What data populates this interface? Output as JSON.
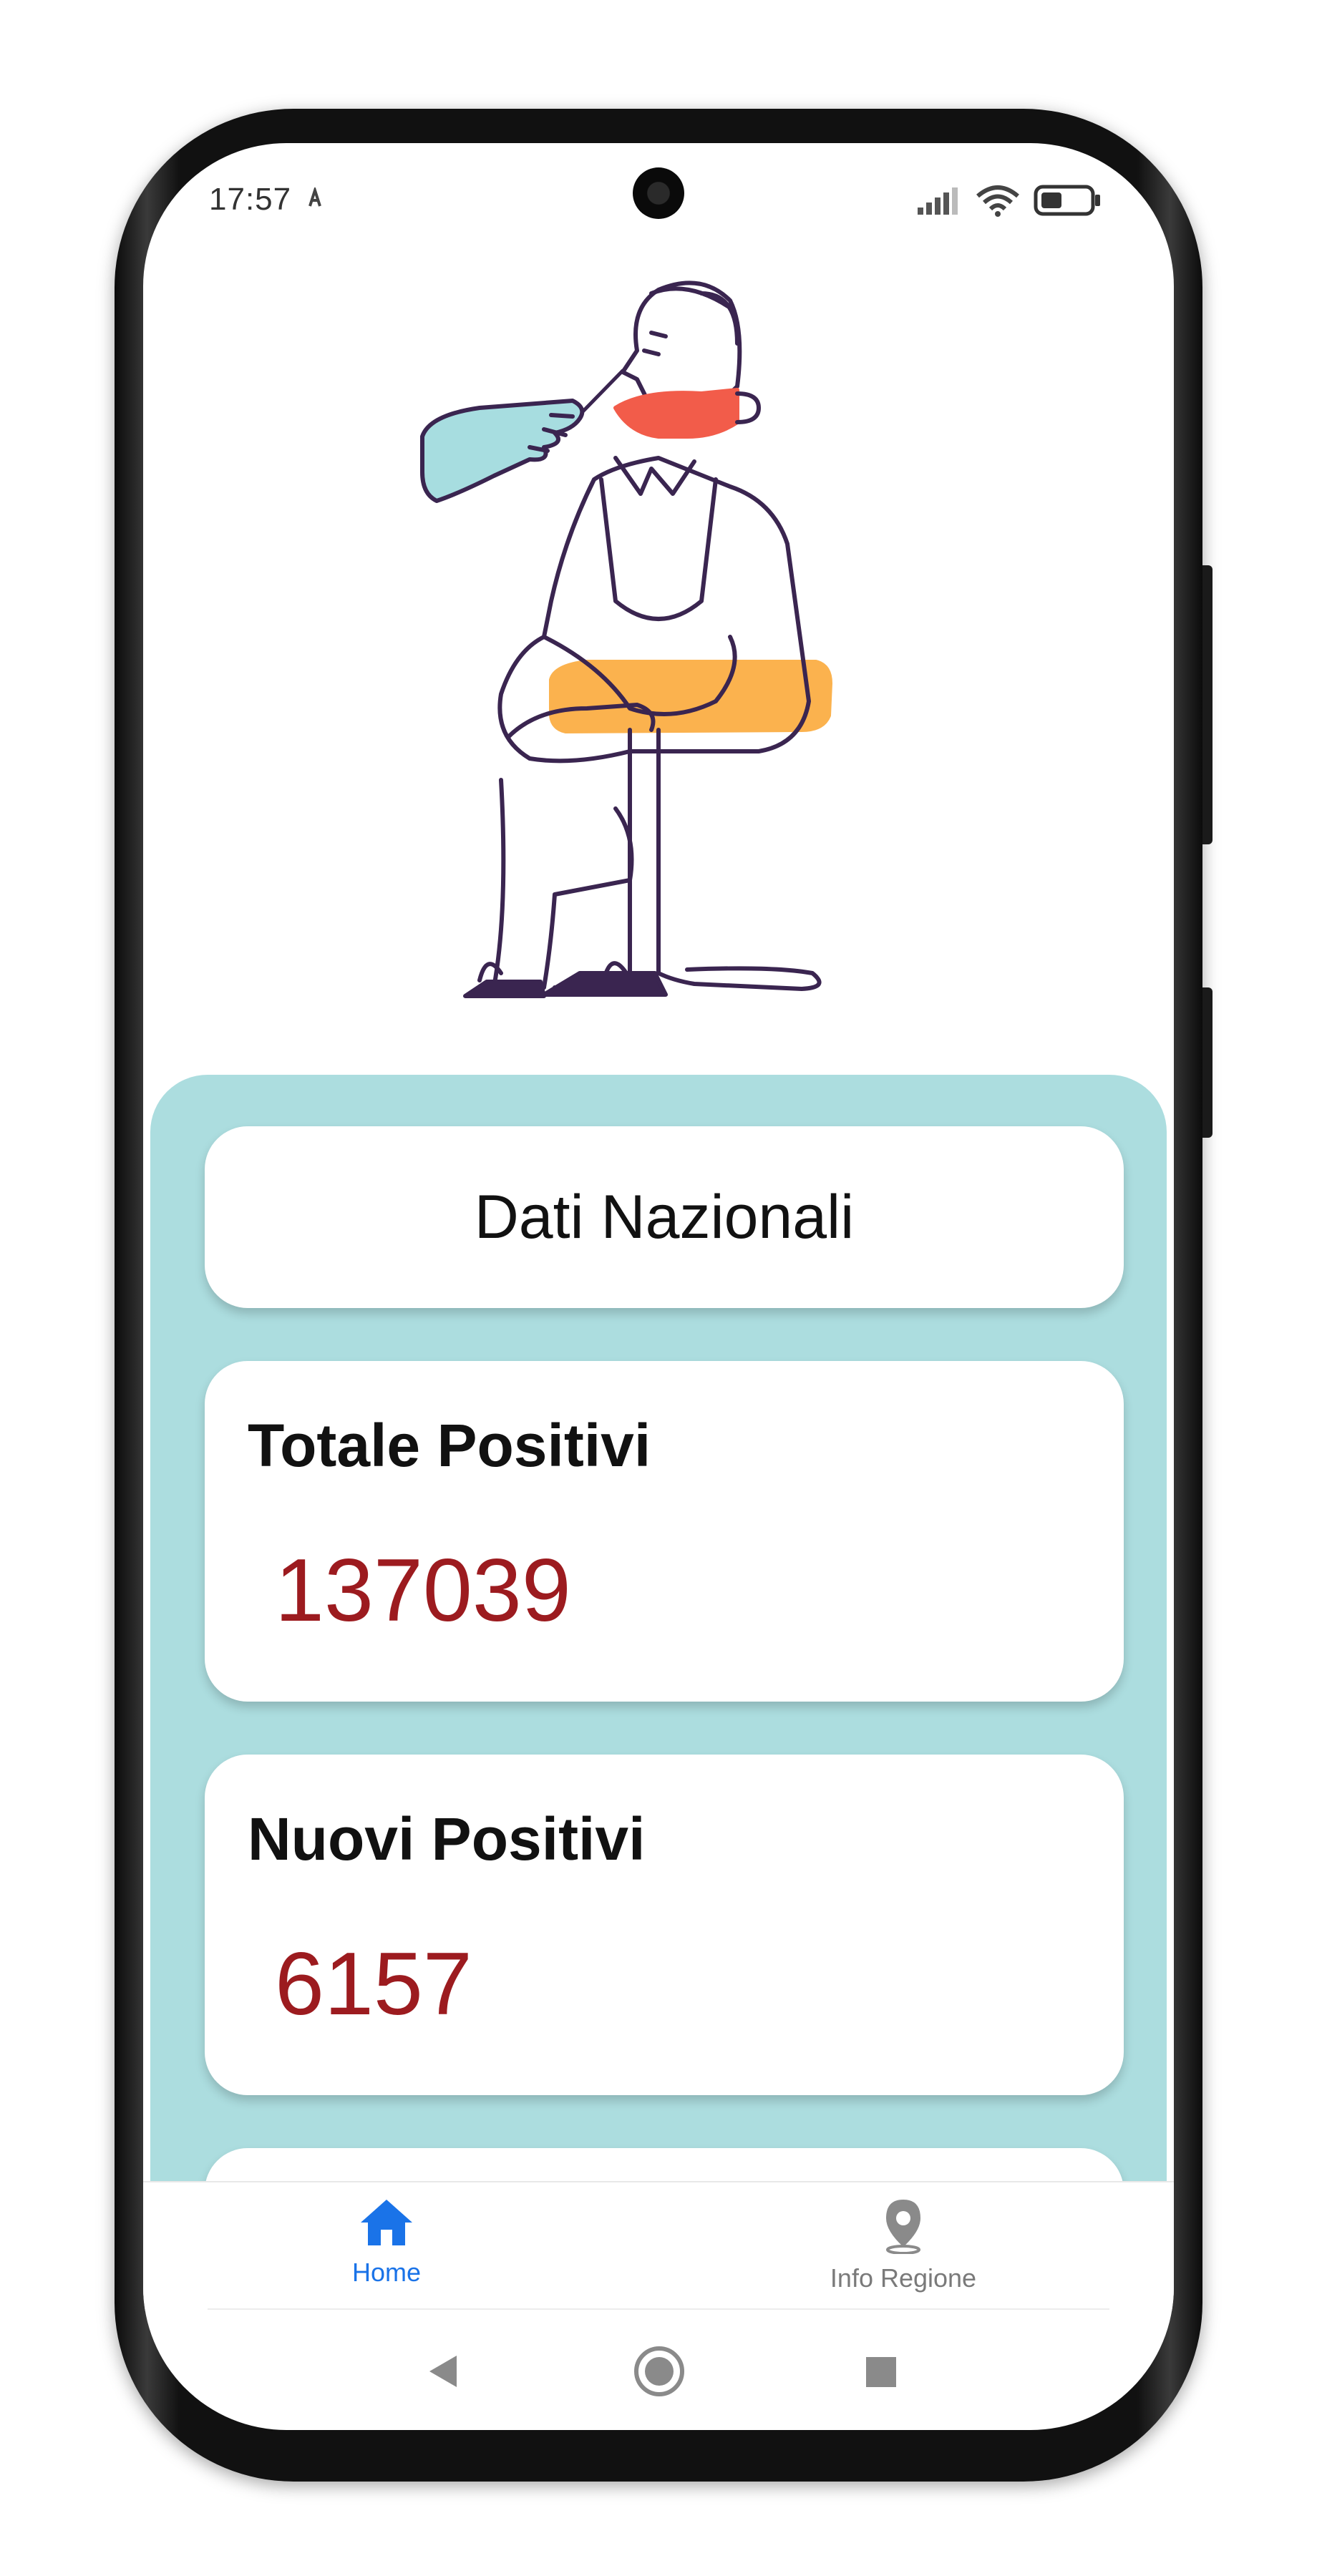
{
  "status_bar": {
    "time": "17:57",
    "icons": [
      "signal-icon",
      "wifi-icon",
      "battery-icon"
    ]
  },
  "illustration": {
    "subject": "person-nasal-swab-illustration"
  },
  "header_card": {
    "title": "Dati Nazionali"
  },
  "stats": [
    {
      "label": "Totale Positivi",
      "value": "137039"
    },
    {
      "label": "Nuovi Positivi",
      "value": "6157"
    }
  ],
  "bottom_nav": {
    "items": [
      {
        "label": "Home",
        "icon": "home-icon",
        "active": true
      },
      {
        "label": "Info Regione",
        "icon": "location-pin-icon",
        "active": false
      }
    ]
  },
  "colors": {
    "panel": "#acdddf",
    "value_red": "#9c1b1f",
    "active_blue": "#1a73e8",
    "inactive_gray": "#7a7a7a"
  }
}
